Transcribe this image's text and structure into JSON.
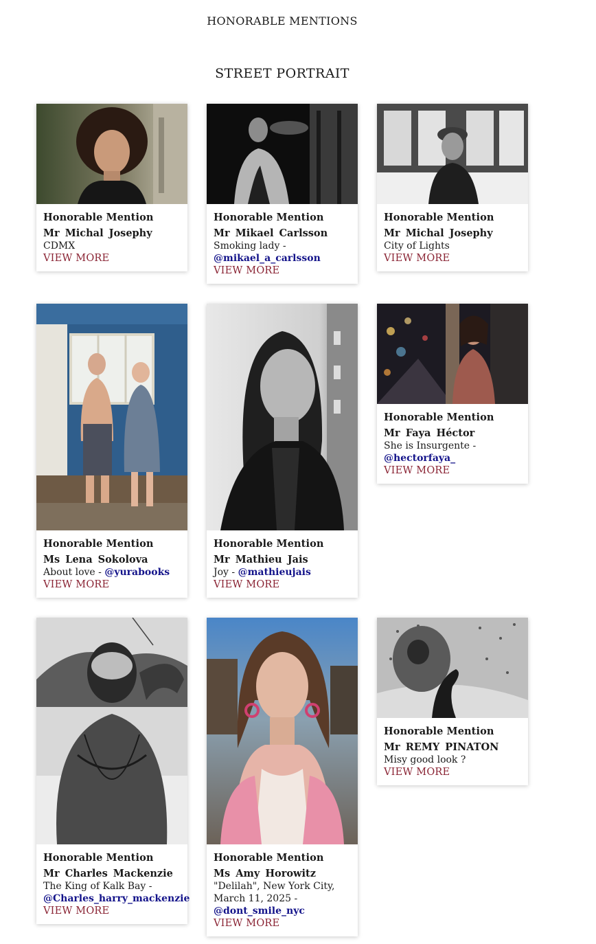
{
  "page": {
    "heading": "HONORABLE MENTIONS",
    "section_title": "STREET PORTRAIT"
  },
  "cards": [
    {
      "award": "Honorable Mention",
      "name": "Mr  Michal  Josephy",
      "title": "CDMX",
      "separator": "",
      "handle": "",
      "more": "VIEW MORE",
      "photo": "woman-curly-hair-portrait"
    },
    {
      "award": "Honorable Mention",
      "name": "Mr  Mikael  Carlsson",
      "title": "Smoking lady",
      "separator": " - ",
      "handle": "@mikael_a_carlsson",
      "more": "VIEW MORE",
      "photo": "smoking-woman-bw"
    },
    {
      "award": "Honorable Mention",
      "name": "Mr  Michal  Josephy",
      "title": "City of Lights",
      "separator": "",
      "handle": "",
      "more": "VIEW MORE",
      "photo": "woman-beret-bw"
    },
    {
      "award": "Honorable Mention",
      "name": "Ms  Lena  Sokolova",
      "title": "About love",
      "separator": " - ",
      "handle": "@yurabooks",
      "more": "VIEW MORE",
      "photo": "couple-blue-hut"
    },
    {
      "award": "Honorable Mention",
      "name": "Mr  Mathieu  Jais",
      "title": "Joy",
      "separator": " - ",
      "handle": "@mathieujais",
      "more": "VIEW MORE",
      "photo": "smiling-woman-leather-jacket-bw"
    },
    {
      "award": "Honorable Mention",
      "name": "Mr  Faya  Héctor",
      "title": "She is Insurgente",
      "separator": " - ",
      "handle": "@hectorfaya_",
      "more": "VIEW MORE",
      "photo": "woman-night-street"
    },
    {
      "award": "Honorable Mention",
      "name": "Mr  Charles  Mackenzie",
      "title": "The King of Kalk Bay",
      "separator": " - ",
      "handle": "@Charles_harry_mackenzie",
      "more": "VIEW MORE",
      "photo": "tattooed-man-bw"
    },
    {
      "award": "Honorable Mention",
      "name": "Ms  Amy  Horowitz",
      "title": "\"Delilah\", New York City, March 11, 2025",
      "separator": " - ",
      "handle": "@dont_smile_nyc",
      "more": "VIEW MORE",
      "photo": "young-woman-pink-cardigan"
    },
    {
      "award": "Honorable Mention",
      "name": "Mr  REMY  PINATON",
      "title": "Misy good look ?",
      "separator": "",
      "handle": "",
      "more": "VIEW MORE",
      "photo": "hand-covering-face-bw"
    }
  ]
}
